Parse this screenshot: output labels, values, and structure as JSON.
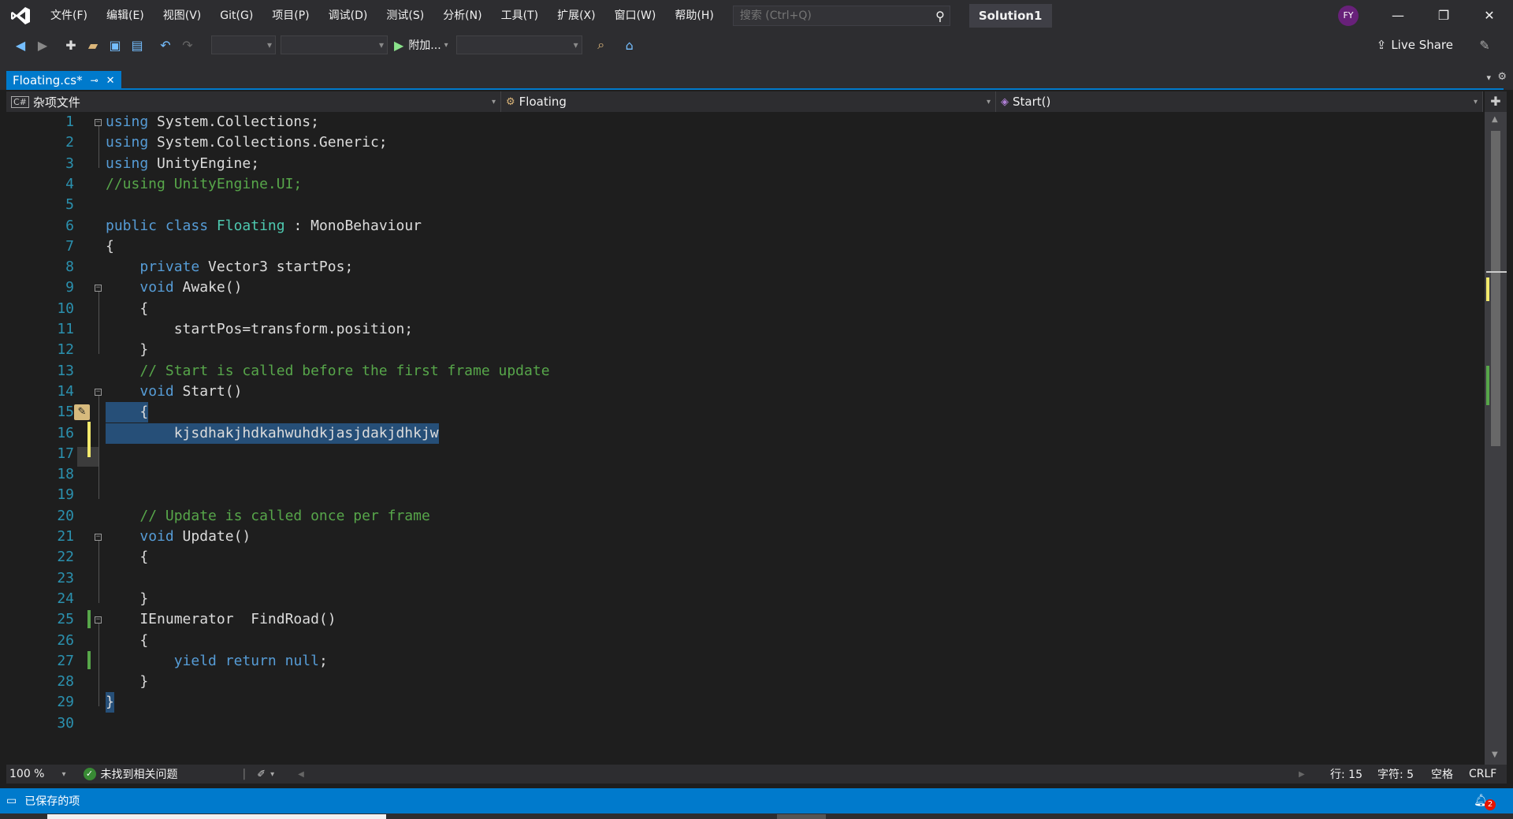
{
  "titlebar": {
    "menu": [
      "文件(F)",
      "编辑(E)",
      "视图(V)",
      "Git(G)",
      "项目(P)",
      "调试(D)",
      "测试(S)",
      "分析(N)",
      "工具(T)",
      "扩展(X)",
      "窗口(W)",
      "帮助(H)"
    ],
    "search_placeholder": "搜索 (Ctrl+Q)",
    "solution": "Solution1",
    "avatar_initials": "FY"
  },
  "toolbar": {
    "attach_label": "附加...",
    "liveshare_label": "Live Share"
  },
  "tab": {
    "label": "Floating.cs*",
    "pin_icon": "pin-icon",
    "close_icon": "close-icon"
  },
  "navbar": {
    "project": "杂项文件",
    "class": "Floating",
    "member": "Start()"
  },
  "code": {
    "lines": [
      {
        "n": "1",
        "tokens": [
          [
            "kw",
            "using"
          ],
          [
            "pl",
            " System.Collections;"
          ]
        ]
      },
      {
        "n": "2",
        "tokens": [
          [
            "kw",
            "using"
          ],
          [
            "pl",
            " System.Collections.Generic;"
          ]
        ]
      },
      {
        "n": "3",
        "tokens": [
          [
            "kw",
            "using"
          ],
          [
            "pl",
            " UnityEngine;"
          ]
        ]
      },
      {
        "n": "4",
        "tokens": [
          [
            "cm",
            "//using UnityEngine.UI;"
          ]
        ]
      },
      {
        "n": "5",
        "tokens": []
      },
      {
        "n": "6",
        "tokens": [
          [
            "kw",
            "public"
          ],
          [
            "pl",
            " "
          ],
          [
            "kw",
            "class"
          ],
          [
            "pl",
            " "
          ],
          [
            "ty",
            "Floating"
          ],
          [
            "pl",
            " : MonoBehaviour"
          ]
        ]
      },
      {
        "n": "7",
        "tokens": [
          [
            "pl",
            "{"
          ]
        ]
      },
      {
        "n": "8",
        "tokens": [
          [
            "pl",
            "    "
          ],
          [
            "kw",
            "private"
          ],
          [
            "pl",
            " Vector3 startPos;"
          ]
        ]
      },
      {
        "n": "9",
        "tokens": [
          [
            "pl",
            "    "
          ],
          [
            "kw",
            "void"
          ],
          [
            "pl",
            " Awake()"
          ]
        ]
      },
      {
        "n": "10",
        "tokens": [
          [
            "pl",
            "    {"
          ]
        ]
      },
      {
        "n": "11",
        "tokens": [
          [
            "pl",
            "        startPos=transform.position;"
          ]
        ]
      },
      {
        "n": "12",
        "tokens": [
          [
            "pl",
            "    }"
          ]
        ]
      },
      {
        "n": "13",
        "tokens": [
          [
            "pl",
            "    "
          ],
          [
            "cm",
            "// Start is called before the first frame update"
          ]
        ]
      },
      {
        "n": "14",
        "tokens": [
          [
            "pl",
            "    "
          ],
          [
            "kw",
            "void"
          ],
          [
            "pl",
            " Start()"
          ]
        ]
      },
      {
        "n": "15",
        "tokens": [
          [
            "pl",
            "    {"
          ]
        ]
      },
      {
        "n": "16",
        "tokens": [
          [
            "pl",
            "        kjsdhakjhdkahwuhdkjasjdakjdhkjw"
          ]
        ]
      },
      {
        "n": "17",
        "tokens": []
      },
      {
        "n": "18",
        "tokens": []
      },
      {
        "n": "19",
        "tokens": []
      },
      {
        "n": "20",
        "tokens": [
          [
            "pl",
            "    "
          ],
          [
            "cm",
            "// Update is called once per frame"
          ]
        ]
      },
      {
        "n": "21",
        "tokens": [
          [
            "pl",
            "    "
          ],
          [
            "kw",
            "void"
          ],
          [
            "pl",
            " Update()"
          ]
        ]
      },
      {
        "n": "22",
        "tokens": [
          [
            "pl",
            "    {"
          ]
        ]
      },
      {
        "n": "23",
        "tokens": []
      },
      {
        "n": "24",
        "tokens": [
          [
            "pl",
            "    }"
          ]
        ]
      },
      {
        "n": "25",
        "tokens": [
          [
            "pl",
            "    IEnumerator  FindRoad()"
          ]
        ]
      },
      {
        "n": "26",
        "tokens": [
          [
            "pl",
            "    {"
          ]
        ]
      },
      {
        "n": "27",
        "tokens": [
          [
            "pl",
            "        "
          ],
          [
            "kw",
            "yield"
          ],
          [
            "pl",
            " "
          ],
          [
            "kw",
            "return"
          ],
          [
            "pl",
            " "
          ],
          [
            "kw",
            "null"
          ],
          [
            "pl",
            ";"
          ]
        ]
      },
      {
        "n": "28",
        "tokens": [
          [
            "pl",
            "    }"
          ]
        ]
      },
      {
        "n": "29",
        "tokens": [
          [
            "pl",
            "}"
          ]
        ]
      },
      {
        "n": "30",
        "tokens": []
      }
    ]
  },
  "editor_footer": {
    "zoom": "100 %",
    "issues": "未找到相关问题",
    "line": "行: 15",
    "col": "字符: 5",
    "spaces": "空格",
    "eol": "CRLF"
  },
  "statusbar": {
    "message": "已保存的项",
    "notifications": "2"
  },
  "colors": {
    "accent": "#007acc",
    "keyword": "#569cd6",
    "type": "#4ec9b0",
    "comment": "#57a64a",
    "selection": "#264f78"
  }
}
